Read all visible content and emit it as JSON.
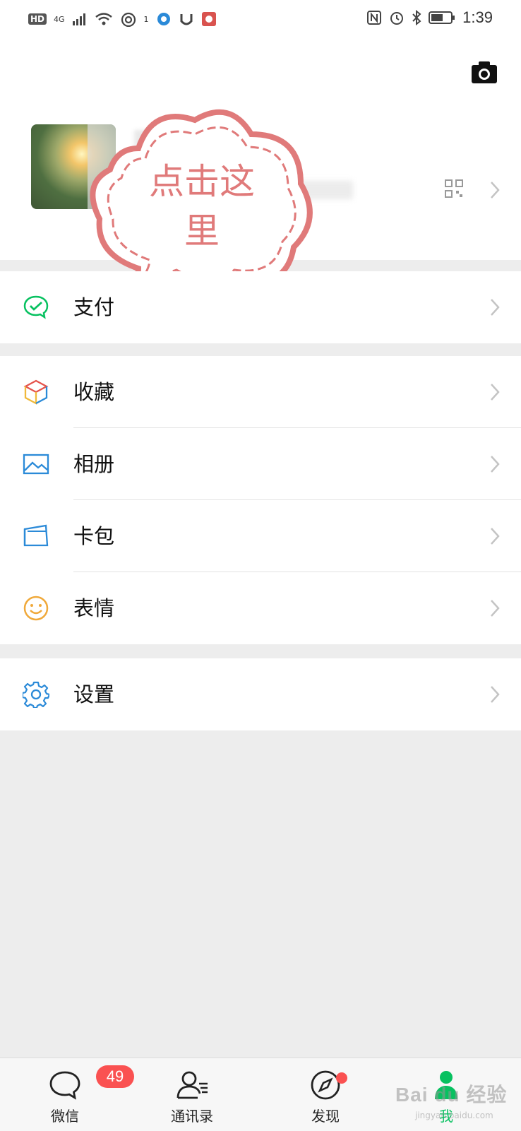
{
  "status_bar": {
    "hd": "HD",
    "network": "4G",
    "signal_tag": "1",
    "time": "1:39"
  },
  "callout": {
    "line1": "点击这",
    "line2": "里",
    "color": "#e07a7a"
  },
  "menu": {
    "pay": {
      "label": "支付",
      "icon": "wechat-pay-icon",
      "color": "#07c160"
    },
    "favorites": {
      "label": "收藏",
      "icon": "cube-icon"
    },
    "album": {
      "label": "相册",
      "icon": "image-icon",
      "color": "#2b8ad8"
    },
    "cards": {
      "label": "卡包",
      "icon": "card-wallet-icon",
      "color": "#2b8ad8"
    },
    "stickers": {
      "label": "表情",
      "icon": "smiley-icon",
      "color": "#f0a93b"
    },
    "settings": {
      "label": "设置",
      "icon": "gear-icon",
      "color": "#2b8ad8"
    }
  },
  "tabbar": {
    "tabs": [
      {
        "label": "微信",
        "icon": "chat-bubble-icon",
        "badge": "49"
      },
      {
        "label": "通讯录",
        "icon": "contacts-icon"
      },
      {
        "label": "发现",
        "icon": "compass-icon"
      },
      {
        "label": "我",
        "icon": "person-icon",
        "active": true
      }
    ],
    "active_color": "#07c160",
    "badge_color": "#fa5151"
  },
  "watermark": {
    "text": "Bai du 经验",
    "sub": "jingyan.baidu.com"
  }
}
